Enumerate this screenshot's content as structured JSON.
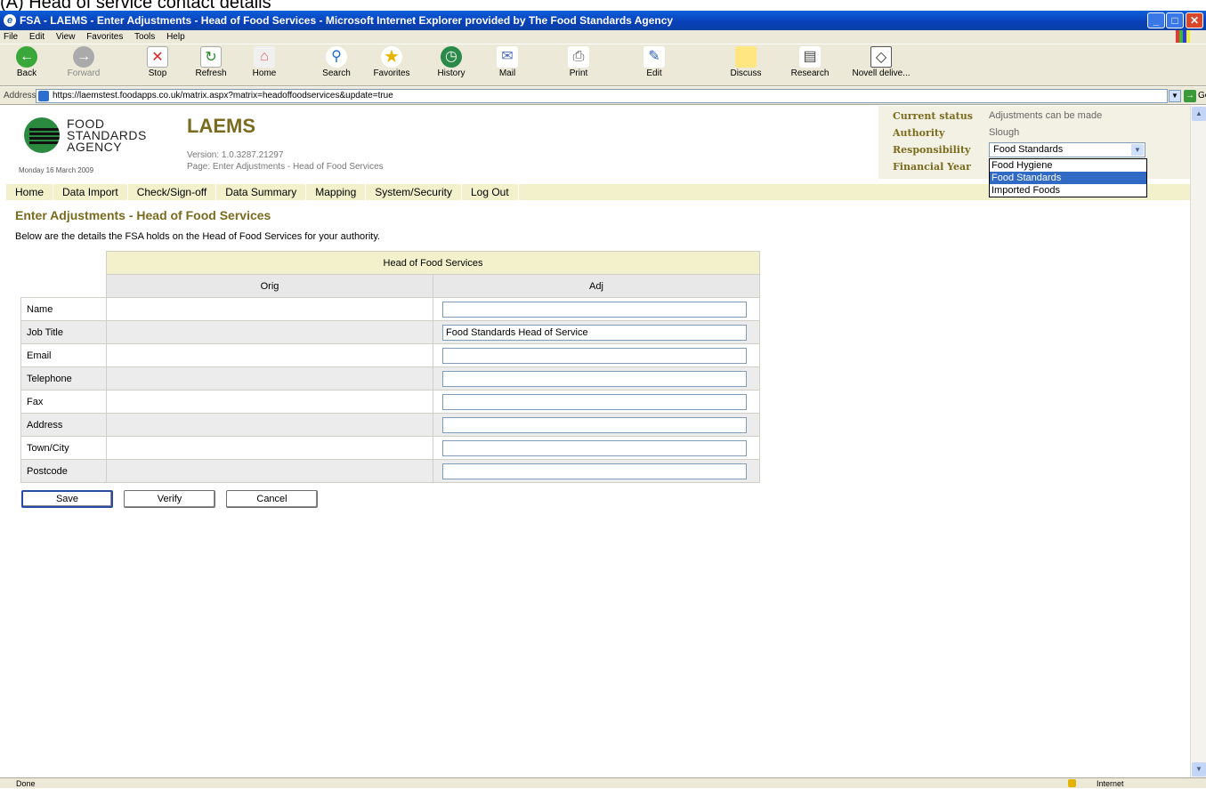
{
  "caption": "(A) Head of service contact details",
  "window": {
    "title": "FSA - LAEMS - Enter Adjustments - Head of Food Services - Microsoft Internet Explorer provided by The Food Standards Agency",
    "min": "_",
    "max": "□",
    "close": "✕"
  },
  "menu": [
    "File",
    "Edit",
    "View",
    "Favorites",
    "Tools",
    "Help"
  ],
  "toolbar": {
    "back": "Back",
    "forward": "Forward",
    "stop": "Stop",
    "refresh": "Refresh",
    "home": "Home",
    "search": "Search",
    "favorites": "Favorites",
    "history": "History",
    "mail": "Mail",
    "print": "Print",
    "edit": "Edit",
    "discuss": "Discuss",
    "research": "Research",
    "novell": "Novell delive..."
  },
  "address": {
    "label": "Address",
    "url": "https://laemstest.foodapps.co.uk/matrix.aspx?matrix=headoffoodservices&update=true",
    "go": "Go"
  },
  "header": {
    "logo_text_1": "FOOD",
    "logo_text_2": "STANDARDS",
    "logo_text_3": "AGENCY",
    "app_title": "LAEMS",
    "version": "Version: 1.0.3287.21297",
    "page": "Page: Enter Adjustments - Head of Food Services",
    "date": "Monday 16 March 2009"
  },
  "status": {
    "current_label": "Current status",
    "current_value": "Adjustments can be made",
    "authority_label": "Authority",
    "authority_value": "Slough",
    "responsibility_label": "Responsibility",
    "responsibility_value": "Food Standards",
    "financial_label": "Financial Year",
    "options": [
      "Food Hygiene",
      "Food Standards",
      "Imported Foods"
    ]
  },
  "nav": [
    "Home",
    "Data Import",
    "Check/Sign-off",
    "Data Summary",
    "Mapping",
    "System/Security",
    "Log Out"
  ],
  "main": {
    "heading": "Enter Adjustments - Head of Food Services",
    "intro": "Below are the details the FSA holds on the Head of Food Services for your authority.",
    "table_title": "Head of Food Services",
    "col_orig": "Orig",
    "col_adj": "Adj",
    "rows": [
      {
        "label": "Name",
        "orig": "",
        "adj": ""
      },
      {
        "label": "Job Title",
        "orig": "",
        "adj": "Food Standards Head of Service"
      },
      {
        "label": "Email",
        "orig": "",
        "adj": ""
      },
      {
        "label": "Telephone",
        "orig": "",
        "adj": ""
      },
      {
        "label": "Fax",
        "orig": "",
        "adj": ""
      },
      {
        "label": "Address",
        "orig": "",
        "adj": ""
      },
      {
        "label": "Town/City",
        "orig": "",
        "adj": ""
      },
      {
        "label": "Postcode",
        "orig": "",
        "adj": ""
      }
    ],
    "save": "Save",
    "verify": "Verify",
    "cancel": "Cancel"
  },
  "statusbar": {
    "left": "Done",
    "zone": "Internet"
  }
}
